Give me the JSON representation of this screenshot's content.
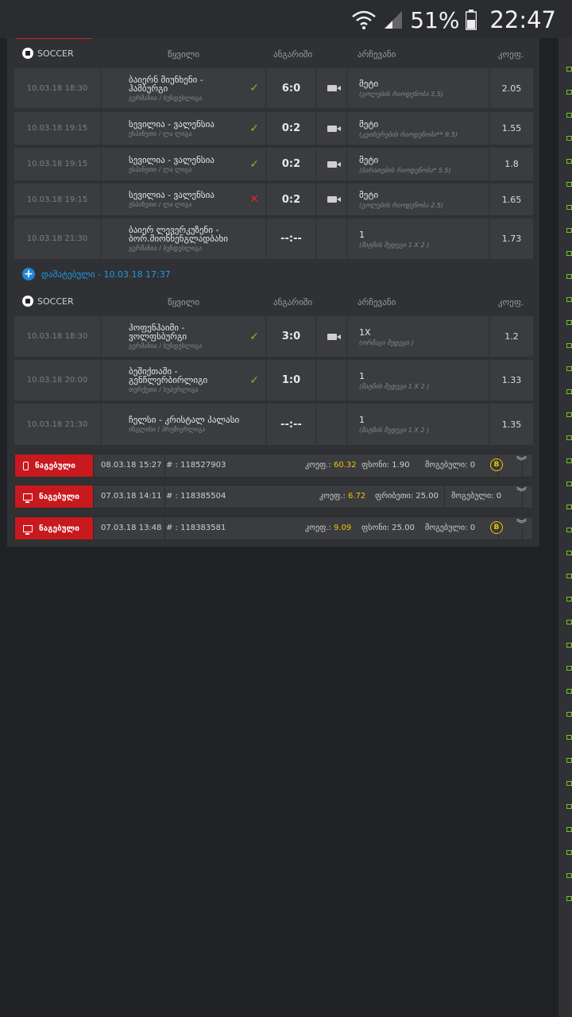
{
  "statusbar": {
    "battery": "51%",
    "time": "22:47"
  },
  "headers": {
    "sport": "SOCCER",
    "event": "წყვილი",
    "score": "ანგარიში",
    "selection": "არჩევანი",
    "odds": "კოეფ."
  },
  "section1": {
    "rows": [
      {
        "date": "10.03.18 18:30",
        "match": "ბაიერნ მიუნხენი - ჰამბურგი",
        "league": "გერმანია / ბუნდესლიგა",
        "status": "win",
        "score": "6:0",
        "video": true,
        "selection": "მეტი",
        "market": "(გოლების რაოდენობა 3.5)",
        "odds": "2.05"
      },
      {
        "date": "10.03.18 19:15",
        "match": "სევილია - ვალენსია",
        "league": "ესპანეთი / ლა ლიგა",
        "status": "win",
        "score": "0:2",
        "video": true,
        "selection": "მეტი",
        "market": "(კუთხურების რაოდენობა** 9.5)",
        "odds": "1.55"
      },
      {
        "date": "10.03.18 19:15",
        "match": "სევილია - ვალენსია",
        "league": "ესპანეთი / ლა ლიგა",
        "status": "win",
        "score": "0:2",
        "video": true,
        "selection": "მეტი",
        "market": "(ბარათების რაოდენობა* 5.5)",
        "odds": "1.8"
      },
      {
        "date": "10.03.18 19:15",
        "match": "სევილია - ვალენსია",
        "league": "ესპანეთი / ლა ლიგა",
        "status": "lose",
        "score": "0:2",
        "video": true,
        "selection": "მეტი",
        "market": "(გოლების რაოდენობა 2.5)",
        "odds": "1.65"
      },
      {
        "date": "10.03.18 21:30",
        "match": "ბაიერ ლევერკუზენი - ბორ.მიონხენგლადბახი",
        "league": "გერმანია / ბუნდესლიგა",
        "status": "",
        "score": "--:--",
        "video": false,
        "selection": "1",
        "market": "(მატჩის შედეგი 1 X 2 )",
        "odds": "1.73"
      }
    ]
  },
  "added_label": "დამატებული - 10.03.18 17:37",
  "section2": {
    "rows": [
      {
        "date": "10.03.18 18:30",
        "match": "ჰოფენჰაიმი - ვოლფსბურგი",
        "league": "გერმანია / ბუნდესლიგა",
        "status": "win",
        "score": "3:0",
        "video": true,
        "selection": "1X",
        "market": "(ორმაგი შედეგი )",
        "odds": "1.2"
      },
      {
        "date": "10.03.18 20:00",
        "match": "ბეშიქთაში - გენჩლერბირლიგი",
        "league": "თურქეთი / სუპერლიგა",
        "status": "win",
        "score": "1:0",
        "video": false,
        "selection": "1",
        "market": "(მატჩის შედეგი 1 X 2 )",
        "odds": "1.33"
      },
      {
        "date": "10.03.18 21:30",
        "match": "ჩელსი - კრისტალ პალასი",
        "league": "ინგლისი / პრემიერლიგა",
        "status": "",
        "score": "--:--",
        "video": false,
        "selection": "1",
        "market": "(მატჩის შედეგი 1 X 2 )",
        "odds": "1.35"
      }
    ]
  },
  "tickets": [
    {
      "device": "phone-icon",
      "status": "ნაგებული",
      "date": "08.03.18 15:27",
      "id": "# : 118527903",
      "odds_label": "კოეფ.:",
      "odds": "60.32",
      "stake_label": "ფსონი:",
      "stake": "1.90",
      "win_label": "მოგებული:",
      "win": "0",
      "badge": "B"
    },
    {
      "device": "desktop-icon",
      "status": "ნაგებული",
      "date": "07.03.18 14:11",
      "id": "# : 118385504",
      "odds_label": "კოეფ.:",
      "odds": "6.72",
      "stake_label": "ფრიბეთი:",
      "stake": "25.00",
      "win_label": "მოგებული:",
      "win": "0",
      "badge": ""
    },
    {
      "device": "desktop-icon",
      "status": "ნაგებული",
      "date": "07.03.18 13:48",
      "id": "# : 118383581",
      "odds_label": "კოეფ.:",
      "odds": "9.09",
      "stake_label": "ფსონი:",
      "stake": "25.00",
      "win_label": "მოგებული:",
      "win": "0",
      "badge": "B"
    }
  ],
  "colors": {
    "win": "#79c21f",
    "lose": "#e02424",
    "accent_red": "#c8191e",
    "link_blue": "#1e9be6",
    "odds_yellow": "#f2c200"
  }
}
